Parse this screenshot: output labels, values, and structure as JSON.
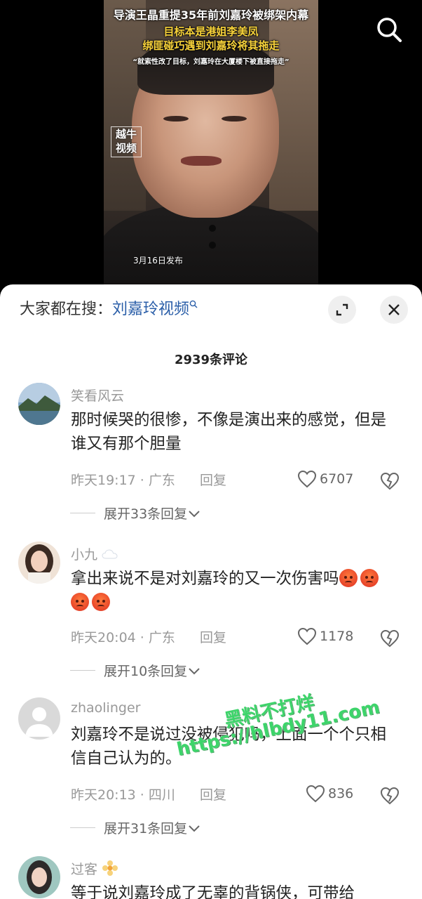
{
  "video": {
    "title_line1": "导演王晶重提35年前刘嘉玲被绑架内幕",
    "title_line2": "目标本是港姐李美凤",
    "title_line3": "绑匪碰巧遇到刘嘉玲将其拖走",
    "title_line4": "“就索性改了目标，刘嘉玲在大厦楼下被直接拖走”",
    "logo_line1": "越牛",
    "logo_line2": "视频",
    "publish_date": "3月16日发布"
  },
  "top_search": {
    "label": "大家都在搜：",
    "term": "刘嘉玲视频"
  },
  "comments_header": {
    "count": "2939条评论"
  },
  "comments": [
    {
      "user": "笑看风云",
      "text": "那时候哭的很惨，不像是演出来的感觉，但是谁又有那个胆量",
      "meta": "昨天19:17 · 广东",
      "reply": "回复",
      "likes": "6707",
      "expand": "展开33条回复"
    },
    {
      "user": "小九",
      "user_icon": "cloud-icon",
      "text": "拿出来说不是对刘嘉玲的又一次伤害吗",
      "emoji": "angry-emoji",
      "meta": "昨天20:04 · 广东",
      "reply": "回复",
      "likes": "1178",
      "expand": "展开10条回复"
    },
    {
      "user": "zhaolinger",
      "text": "刘嘉玲不是说过没被侵犯吗，上面一个个只相信自己认为的。",
      "meta": "昨天20:13 · 四川",
      "reply": "回复",
      "likes": "836",
      "expand": "展开31条回复"
    },
    {
      "user": "过客",
      "user_icon": "flower-icon",
      "text": "等于说刘嘉玲成了无辜的背锅侠，可带给"
    }
  ],
  "watermark": {
    "line1": "黑料不打烊",
    "line2": "https://hlbdy11.com"
  },
  "colors": {
    "accent_link": "#2a5ea8",
    "title_yellow": "#f7d23a",
    "watermark_green": "#3dd46a"
  }
}
